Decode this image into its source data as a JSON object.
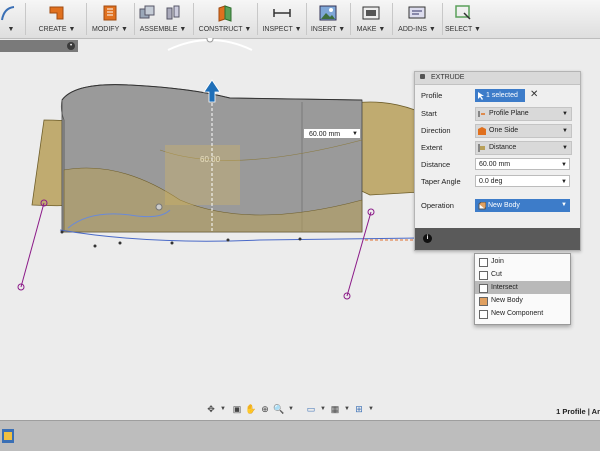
{
  "toolbar": {
    "groups": [
      {
        "label": "▼"
      },
      {
        "label": "CREATE ▼"
      },
      {
        "label": "MODIFY ▼"
      },
      {
        "label": "ASSEMBLE ▼"
      },
      {
        "label": "CONSTRUCT ▼"
      },
      {
        "label": "INSPECT ▼"
      },
      {
        "label": "INSERT ▼"
      },
      {
        "label": "MAKE ▼"
      },
      {
        "label": "ADD-INS ▼"
      },
      {
        "label": "SELECT ▼"
      }
    ],
    "accent_color": "#e0701e"
  },
  "viewport": {
    "dimension_value": "60.00 mm",
    "ghost_dimension": "60.00",
    "body_color": "#b8a05a",
    "sketch_color": "#8b1a88"
  },
  "panel": {
    "title": "EXTRUDE",
    "rows": [
      {
        "label": "Profile",
        "value": "1 selected",
        "clear": "✕"
      },
      {
        "label": "Start",
        "value": "Profile Plane"
      },
      {
        "label": "Direction",
        "value": "One Side"
      },
      {
        "label": "Extent",
        "value": "Distance"
      },
      {
        "label": "Distance",
        "value": "60.00 mm"
      },
      {
        "label": "Taper Angle",
        "value": "0.0 deg"
      },
      {
        "label": "Operation",
        "value": "New Body"
      }
    ],
    "info_icon": "i"
  },
  "dropdown": {
    "options": [
      "Join",
      "Cut",
      "Intersect",
      "New Body",
      "New Component"
    ],
    "highlighted": "Intersect"
  },
  "status": {
    "text": "1 Profile | Ar"
  }
}
